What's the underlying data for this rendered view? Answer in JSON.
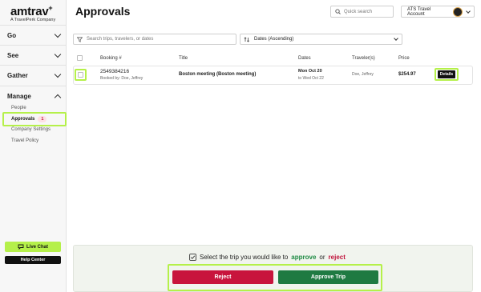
{
  "brand": {
    "name": "amtrav",
    "tagline": "A TravelPerk Company"
  },
  "sidebar": {
    "sections": [
      {
        "label": "Go",
        "expanded": false
      },
      {
        "label": "See",
        "expanded": false
      },
      {
        "label": "Gather",
        "expanded": false
      },
      {
        "label": "Manage",
        "expanded": true
      }
    ],
    "manage_items": [
      {
        "label": "People"
      },
      {
        "label": "Approvals",
        "badge": "1",
        "active": true
      },
      {
        "label": "Company Settings"
      },
      {
        "label": "Travel Policy"
      }
    ],
    "live_chat": "Live Chat",
    "help_center": "Help Center"
  },
  "header": {
    "title": "Approvals",
    "quick_search_placeholder": "Quick search",
    "account": "ATS Travel Account"
  },
  "filters": {
    "search_placeholder": "Search trips, travelers, or dates",
    "sort_value": "Dates (Ascending)"
  },
  "table": {
    "headers": {
      "booking": "Booking #",
      "title": "Title",
      "dates": "Dates",
      "travelers": "Traveler(s)",
      "price": "Price"
    },
    "rows": [
      {
        "booking_number": "2549384216",
        "booked_by": "Booked by: Doe, Jeffrey",
        "title": "Boston meeting (Boston meeting)",
        "date_start": "Mon Oct 20",
        "date_end": "to Wed Oct 22",
        "travelers": "Doe, Jeffrey",
        "price": "$254.97",
        "details_label": "Details"
      }
    ]
  },
  "action_panel": {
    "prompt_before": "Select the trip you would like to",
    "prompt_approve": "approve",
    "prompt_or": "or",
    "prompt_reject": "reject",
    "reject_label": "Reject",
    "approve_label": "Approve Trip"
  },
  "colors": {
    "accent": "#b5f04a",
    "reject": "#c8143c",
    "approve": "#1f7a42"
  }
}
